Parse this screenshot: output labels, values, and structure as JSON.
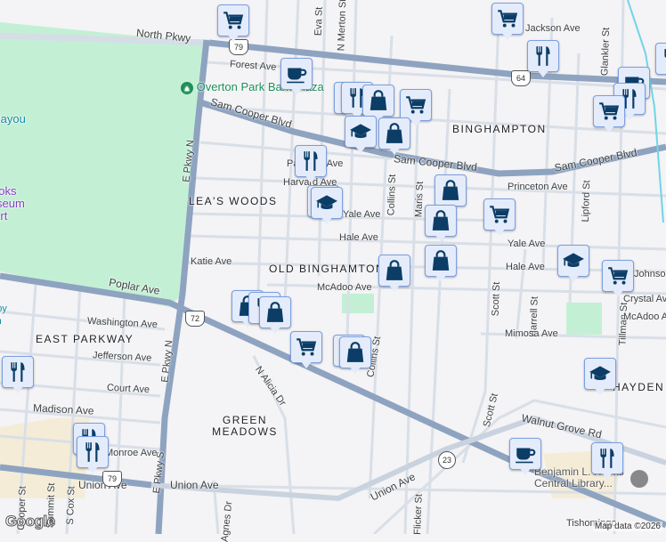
{
  "map": {
    "colors": {
      "road_major": "#8ea3c0",
      "road_minor": "#d5dde6",
      "park": "#c3f0d5",
      "marker_bg": "#e4ecfb",
      "marker_icon": "#0b3d66"
    },
    "neighborhoods": [
      "LEA'S WOODS",
      "OLD BINGHAMTON",
      "BINGHAMPTON",
      "EAST PARKWAY",
      "GREEN MEADOWS",
      "HAYDEN PL"
    ],
    "streets": [
      "North Pkwy",
      "Forest Ave",
      "Sam Cooper Blvd",
      "Sam Cooper Blvd",
      "E Pkwy N",
      "E Pkwy N",
      "E Pkwy S",
      "Katie Ave",
      "Poplar Ave",
      "Washington Ave",
      "Jefferson Ave",
      "Court Ave",
      "Madison Ave",
      "Monroe Ave",
      "Union Ave",
      "Union Ave",
      "Union Ave",
      "N Alicia Dr",
      "Agnes Dr",
      "Hale Ave",
      "Yale Ave",
      "Yale Ave",
      "Hale Ave",
      "McAdoo Ave",
      "Princeton Ave",
      "Collins St",
      "Collins St",
      "Maris St",
      "Scott St",
      "Scott St",
      "Harrell St",
      "Lipford St",
      "Glankler St",
      "Tillman St",
      "Mimosa Ave",
      "Walnut Grove Rd",
      "Flicker St",
      "Tishomingo",
      "Johnson Ave",
      "Crystal Ave",
      "McAdoo Ave",
      "Eva St",
      "N Merton St",
      "Jackson Ave",
      "Parkway Ave",
      "Harvard Ave",
      "S Cox St",
      "Summit St",
      "Cooper St"
    ],
    "pois": {
      "park": "Overton Park Bark Plaza",
      "museum": "Brooks Museum of Art",
      "water": "Bayou",
      "library": "Benjamin L. Hooks Central Library...",
      "ranch": "Lovejoy Ranch"
    },
    "shields": [
      "79",
      "64",
      "72",
      "79",
      "23"
    ],
    "markers": [
      "cart",
      "coffee",
      "restaurant",
      "restaurant",
      "bag",
      "cart",
      "graduation",
      "bag",
      "cart",
      "restaurant",
      "restaurant",
      "coffee",
      "restaurant",
      "cart",
      "restaurant",
      "graduation",
      "graduation",
      "bag",
      "bag",
      "bag",
      "bag",
      "cart",
      "graduation",
      "cart",
      "bag",
      "restaurant",
      "bag",
      "cart",
      "restaurant",
      "bag",
      "restaurant",
      "restaurant",
      "restaurant",
      "graduation",
      "coffee",
      "restaurant"
    ],
    "attribution": "Map data ©2026",
    "logo": "Google"
  }
}
